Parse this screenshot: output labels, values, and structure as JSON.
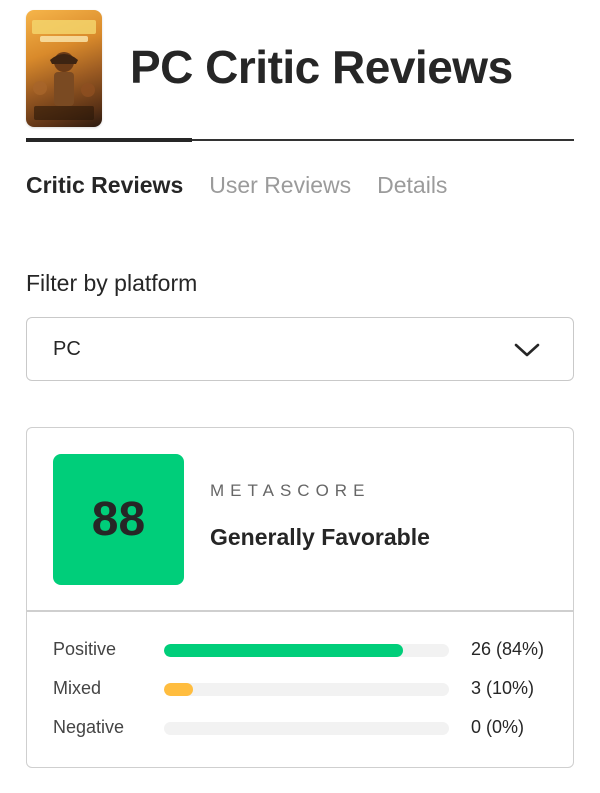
{
  "header": {
    "title": "PC Critic Reviews",
    "cover_icon": "game-cover-art"
  },
  "tabs": [
    {
      "label": "Critic Reviews",
      "active": true
    },
    {
      "label": "User Reviews",
      "active": false
    },
    {
      "label": "Details",
      "active": false
    }
  ],
  "filter": {
    "label": "Filter by platform",
    "selected": "PC",
    "icon": "chevron-down-icon"
  },
  "score": {
    "value": "88",
    "label": "METASCORE",
    "verdict": "Generally Favorable",
    "color": "#00ce7a"
  },
  "distribution": [
    {
      "label": "Positive",
      "count": "26 (84%)",
      "fraction": 0.84,
      "color": "#00ce7a"
    },
    {
      "label": "Mixed",
      "count": "3 (10%)",
      "fraction": 0.1,
      "color": "#ffbd3f"
    },
    {
      "label": "Negative",
      "count": "0 (0%)",
      "fraction": 0.0,
      "color": "#ff6874"
    }
  ]
}
